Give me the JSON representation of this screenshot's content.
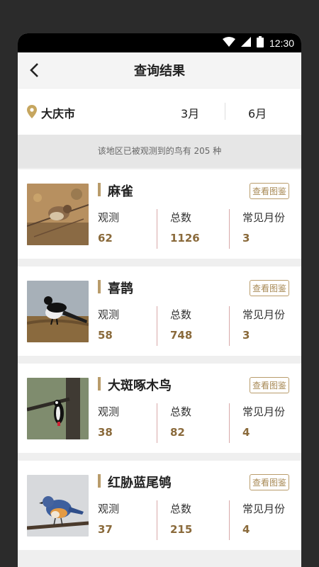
{
  "status": {
    "time": "12:30"
  },
  "header": {
    "title": "查询结果"
  },
  "filter": {
    "location": "大庆市",
    "month_start": "3月",
    "month_end": "6月"
  },
  "summary": {
    "text": "该地区已被观测到的鸟有 205 种"
  },
  "labels": {
    "observe": "观测",
    "total": "总数",
    "common_month": "常见月份",
    "guide_button": "查看图鉴"
  },
  "birds": [
    {
      "name": "麻雀",
      "observe": "62",
      "total": "1126",
      "common_month": "3"
    },
    {
      "name": "喜鹊",
      "observe": "58",
      "total": "748",
      "common_month": "3"
    },
    {
      "name": "大斑啄木鸟",
      "observe": "38",
      "total": "82",
      "common_month": "4"
    },
    {
      "name": "红胁蓝尾鸲",
      "observe": "37",
      "total": "215",
      "common_month": "4"
    }
  ],
  "colors": {
    "accent": "#b99c6b",
    "value": "#8a6a3b",
    "divider": "#d8a8a8",
    "location_pin": "#c6a65f"
  }
}
